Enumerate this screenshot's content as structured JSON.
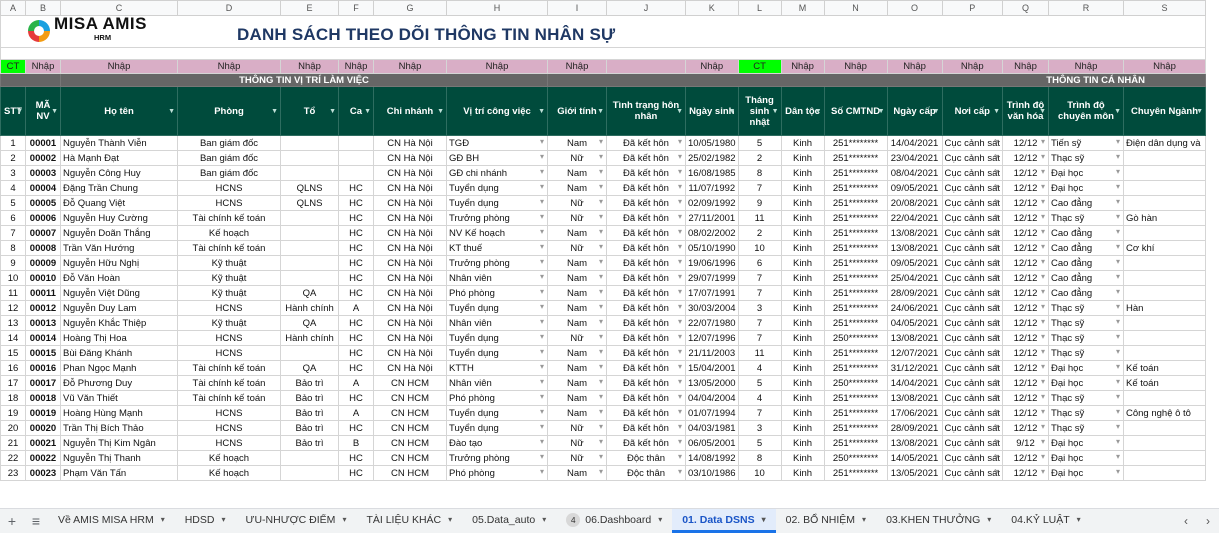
{
  "logo": {
    "brand": "MISA AMIS",
    "sub": "HRM"
  },
  "title": "DANH SÁCH THEO DÕI THÔNG TIN NHÂN SỰ",
  "column_letters": [
    "A",
    "B",
    "C",
    "D",
    "E",
    "F",
    "G",
    "H",
    "I",
    "J",
    "K",
    "L",
    "M",
    "N",
    "O",
    "P",
    "Q",
    "R",
    "S"
  ],
  "input_row": [
    "CT",
    "Nhập",
    "Nhập",
    "Nhập",
    "Nhập",
    "Nhập",
    "Nhập",
    "Nhập",
    "Nhập",
    "",
    "Nhập",
    "CT",
    "Nhập",
    "Nhập",
    "Nhập",
    "Nhập",
    "Nhập",
    "Nhập",
    "Nhập"
  ],
  "group_row": {
    "work": "THÔNG TIN VỊ TRÍ LÀM VIỆC",
    "personal": "THÔNG TIN CÁ NHÂN"
  },
  "headers": [
    "STT",
    "MÃ NV",
    "Họ tên",
    "Phòng",
    "Tổ",
    "Ca",
    "Chi nhánh",
    "Vị trí công việc",
    "Giới tính",
    "Tình trạng hôn nhân",
    "Ngày sinh",
    "Tháng sinh nhật",
    "Dân tộc",
    "Số CMTND",
    "Ngày cấp",
    "Nơi cấp",
    "Trình độ văn hóa",
    "Trình độ chuyên môn",
    "Chuyên Ngành"
  ],
  "rows": [
    [
      "1",
      "00001",
      "Nguyễn Thành Viễn",
      "Ban giám đốc",
      "",
      "",
      "CN Hà Nội",
      "TGĐ",
      "Nam",
      "Đã kết hôn",
      "10/05/1980",
      "5",
      "Kinh",
      "251********",
      "14/04/2021",
      "Cục cảnh sát",
      "12/12",
      "Tiến sỹ",
      "Điện dân dụng và"
    ],
    [
      "2",
      "00002",
      "Hà Mạnh Đạt",
      "Ban giám đốc",
      "",
      "",
      "CN Hà Nội",
      "GĐ BH",
      "Nữ",
      "Đã kết hôn",
      "25/02/1982",
      "2",
      "Kinh",
      "251********",
      "23/04/2021",
      "Cục cảnh sát",
      "12/12",
      "Thạc sỹ",
      ""
    ],
    [
      "3",
      "00003",
      "Nguyễn Công Huy",
      "Ban giám đốc",
      "",
      "",
      "CN Hà Nội",
      "GĐ chi nhánh",
      "Nam",
      "Đã kết hôn",
      "16/08/1985",
      "8",
      "Kinh",
      "251********",
      "08/04/2021",
      "Cục cảnh sát",
      "12/12",
      "Đại học",
      ""
    ],
    [
      "4",
      "00004",
      "Đặng Trần Chung",
      "HCNS",
      "QLNS",
      "HC",
      "CN Hà Nội",
      "Tuyển dụng",
      "Nam",
      "Đã kết hôn",
      "11/07/1992",
      "7",
      "Kinh",
      "251********",
      "09/05/2021",
      "Cục cảnh sát",
      "12/12",
      "Đại học",
      ""
    ],
    [
      "5",
      "00005",
      "Đỗ Quang Việt",
      "HCNS",
      "QLNS",
      "HC",
      "CN Hà Nội",
      "Tuyển dụng",
      "Nữ",
      "Đã kết hôn",
      "02/09/1992",
      "9",
      "Kinh",
      "251********",
      "20/08/2021",
      "Cục cảnh sát",
      "12/12",
      "Cao đẳng",
      ""
    ],
    [
      "6",
      "00006",
      "Nguyễn Huy Cường",
      "Tài chính kế toán",
      "",
      "HC",
      "CN Hà Nội",
      "Trưởng phòng",
      "Nữ",
      "Đã kết hôn",
      "27/11/2001",
      "11",
      "Kinh",
      "251********",
      "22/04/2021",
      "Cục cảnh sát",
      "12/12",
      "Thạc sỹ",
      "Gò hàn"
    ],
    [
      "7",
      "00007",
      "Nguyễn Doãn Thắng",
      "Kế hoạch",
      "",
      "HC",
      "CN Hà Nội",
      "NV Kế hoạch",
      "Nam",
      "Đã kết hôn",
      "08/02/2002",
      "2",
      "Kinh",
      "251********",
      "13/08/2021",
      "Cục cảnh sát",
      "12/12",
      "Cao đẳng",
      ""
    ],
    [
      "8",
      "00008",
      "Trần Văn Hướng",
      "Tài chính kế toán",
      "",
      "HC",
      "CN Hà Nội",
      "KT thuế",
      "Nữ",
      "Đã kết hôn",
      "05/10/1990",
      "10",
      "Kinh",
      "251********",
      "13/08/2021",
      "Cục cảnh sát",
      "12/12",
      "Cao đẳng",
      "Cơ khí"
    ],
    [
      "9",
      "00009",
      "Nguyễn Hữu Nghị",
      "Kỹ thuật",
      "",
      "HC",
      "CN Hà Nội",
      "Trưởng phòng",
      "Nam",
      "Đã kết hôn",
      "19/06/1996",
      "6",
      "Kinh",
      "251********",
      "09/05/2021",
      "Cục cảnh sát",
      "12/12",
      "Cao đẳng",
      ""
    ],
    [
      "10",
      "00010",
      "Đỗ Văn Hoàn",
      "Kỹ thuật",
      "",
      "HC",
      "CN Hà Nội",
      "Nhân viên",
      "Nam",
      "Đã kết hôn",
      "29/07/1999",
      "7",
      "Kinh",
      "251********",
      "25/04/2021",
      "Cục cảnh sát",
      "12/12",
      "Cao đẳng",
      ""
    ],
    [
      "11",
      "00011",
      "Nguyễn Việt Dũng",
      "Kỹ thuật",
      "QA",
      "HC",
      "CN Hà Nội",
      "Phó phòng",
      "Nam",
      "Đã kết hôn",
      "17/07/1991",
      "7",
      "Kinh",
      "251********",
      "28/09/2021",
      "Cục cảnh sát",
      "12/12",
      "Cao đẳng",
      ""
    ],
    [
      "12",
      "00012",
      "Nguyễn Duy Lam",
      "HCNS",
      "Hành chính",
      "A",
      "CN Hà Nội",
      "Tuyển dụng",
      "Nam",
      "Đã kết hôn",
      "30/03/2004",
      "3",
      "Kinh",
      "251********",
      "24/06/2021",
      "Cục cảnh sát",
      "12/12",
      "Thạc sỹ",
      "Hàn"
    ],
    [
      "13",
      "00013",
      "Nguyễn Khắc Thiệp",
      "Kỹ thuật",
      "QA",
      "HC",
      "CN Hà Nội",
      "Nhân viên",
      "Nam",
      "Đã kết hôn",
      "22/07/1980",
      "7",
      "Kinh",
      "251********",
      "04/05/2021",
      "Cục cảnh sát",
      "12/12",
      "Thạc sỹ",
      ""
    ],
    [
      "14",
      "00014",
      "Hoàng Thị Hoa",
      "HCNS",
      "Hành chính",
      "HC",
      "CN Hà Nội",
      "Tuyển dụng",
      "Nữ",
      "Đã kết hôn",
      "12/07/1996",
      "7",
      "Kinh",
      "250********",
      "13/08/2021",
      "Cục cảnh sát",
      "12/12",
      "Thạc sỹ",
      ""
    ],
    [
      "15",
      "00015",
      "Bùi Đăng Khánh",
      "HCNS",
      "",
      "HC",
      "CN Hà Nội",
      "Tuyển dụng",
      "Nam",
      "Đã kết hôn",
      "21/11/2003",
      "11",
      "Kinh",
      "251********",
      "12/07/2021",
      "Cục cảnh sát",
      "12/12",
      "Thạc sỹ",
      ""
    ],
    [
      "16",
      "00016",
      "Phan Ngọc Mạnh",
      "Tài chính kế toán",
      "QA",
      "HC",
      "CN Hà Nội",
      "KTTH",
      "Nam",
      "Đã kết hôn",
      "15/04/2001",
      "4",
      "Kinh",
      "251********",
      "31/12/2021",
      "Cục cảnh sát",
      "12/12",
      "Đại học",
      "Kế toán"
    ],
    [
      "17",
      "00017",
      "Đỗ Phương Duy",
      "Tài chính kế toán",
      "Bảo trì",
      "A",
      "CN HCM",
      "Nhân viên",
      "Nam",
      "Đã kết hôn",
      "13/05/2000",
      "5",
      "Kinh",
      "250********",
      "14/04/2021",
      "Cục cảnh sát",
      "12/12",
      "Đại học",
      "Kế toán"
    ],
    [
      "18",
      "00018",
      "Vũ Văn Thiết",
      "Tài chính kế toán",
      "Bảo trì",
      "HC",
      "CN HCM",
      "Phó phòng",
      "Nam",
      "Đã kết hôn",
      "04/04/2004",
      "4",
      "Kinh",
      "251********",
      "13/08/2021",
      "Cục cảnh sát",
      "12/12",
      "Thạc sỹ",
      ""
    ],
    [
      "19",
      "00019",
      "Hoàng Hùng Mạnh",
      "HCNS",
      "Bảo trì",
      "A",
      "CN HCM",
      "Tuyển dụng",
      "Nam",
      "Đã kết hôn",
      "01/07/1994",
      "7",
      "Kinh",
      "251********",
      "17/06/2021",
      "Cục cảnh sát",
      "12/12",
      "Thạc sỹ",
      "Công nghệ ô tô"
    ],
    [
      "20",
      "00020",
      "Trần Thị Bích Thảo",
      "HCNS",
      "Bảo trì",
      "HC",
      "CN HCM",
      "Tuyển dụng",
      "Nữ",
      "Đã kết hôn",
      "04/03/1981",
      "3",
      "Kinh",
      "251********",
      "28/09/2021",
      "Cục cảnh sát",
      "12/12",
      "Thạc sỹ",
      ""
    ],
    [
      "21",
      "00021",
      "Nguyễn Thị Kim Ngân",
      "HCNS",
      "Bảo trì",
      "B",
      "CN HCM",
      "Đào tạo",
      "Nữ",
      "Đã kết hôn",
      "06/05/2001",
      "5",
      "Kinh",
      "251********",
      "13/08/2021",
      "Cục cảnh sát",
      "9/12",
      "Đại học",
      ""
    ],
    [
      "22",
      "00022",
      "Nguyễn Thị Thanh",
      "Kế hoạch",
      "",
      "HC",
      "CN HCM",
      "Trưởng phòng",
      "Nữ",
      "Độc thân",
      "14/08/1992",
      "8",
      "Kinh",
      "250********",
      "14/05/2021",
      "Cục cảnh sát",
      "12/12",
      "Đại học",
      ""
    ],
    [
      "23",
      "00023",
      "Phạm Văn Tấn",
      "Kế hoạch",
      "",
      "HC",
      "CN HCM",
      "Phó phòng",
      "Nam",
      "Độc thân",
      "03/10/1986",
      "10",
      "Kinh",
      "251********",
      "13/05/2021",
      "Cục cảnh sát",
      "12/12",
      "Đại học",
      ""
    ]
  ],
  "tabs": [
    {
      "label": "Về AMIS MISA HRM",
      "active": false
    },
    {
      "label": "HDSD",
      "active": false
    },
    {
      "label": "ƯU-NHƯỢC ĐIỂM",
      "active": false
    },
    {
      "label": "TÀI LIỆU KHÁC",
      "active": false
    },
    {
      "label": "05.Data_auto",
      "active": false
    },
    {
      "label": "06.Dashboard",
      "active": false,
      "badge": "4"
    },
    {
      "label": "01. Data DSNS",
      "active": true
    },
    {
      "label": "02. BỔ NHIỆM",
      "active": false
    },
    {
      "label": "03.KHEN THƯỞNG",
      "active": false
    },
    {
      "label": "04.KỶ LUẬT",
      "active": false
    }
  ],
  "icons": {
    "add": "plus-icon",
    "all_sheets": "menu-icon",
    "prev": "chevron-left-icon",
    "next": "chevron-right-icon"
  },
  "colors": {
    "header_bg": "#004b3c",
    "input_bg": "#d9aec6",
    "ct_bg": "#00ff00",
    "group_bg": "#666666",
    "title": "#1f3864",
    "active_tab": "#1a55c7"
  }
}
